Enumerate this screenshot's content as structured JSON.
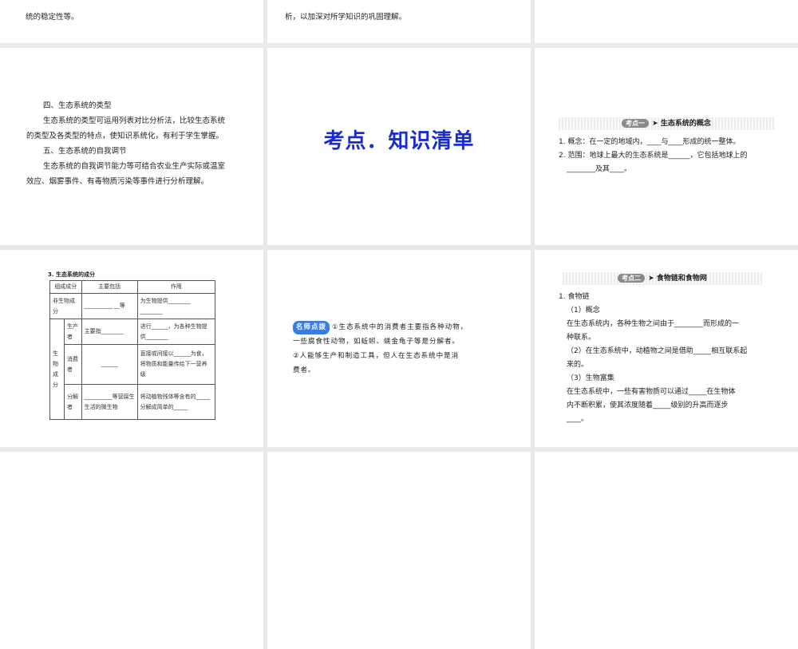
{
  "slides": {
    "s1": {
      "line": "统的稳定性等。"
    },
    "s2": {
      "line": "析，以加深对所学知识的巩固理解。"
    },
    "s4": {
      "lines": [
        "四、生态系统的类型",
        "生态系统的类型可运用列表对比分析法，比较生态系统",
        "的类型及各类型的特点，使知识系统化，有利于学生掌握。",
        "五、生态系统的自我调节",
        "生态系统的自我调节能力等可结合农业生产实际或温室",
        "效应、烟雾事件、有毒物质污染等事件进行分析理解。"
      ]
    },
    "s5": {
      "title": "考点．知识清单"
    },
    "s6": {
      "badge": "考点一",
      "heading": "➤ 生态系统的概念",
      "lines": [
        "1. 概念：在一定的地域内，____与____形成的统一整体。",
        "2. 范围：地球上最大的生态系统是______，它包括地球上的",
        "________及其____。"
      ]
    },
    "s7": {
      "title": "3. 生态系统的成分",
      "headers": [
        "组成成分",
        "主要包括",
        "作用"
      ],
      "nonbio": "非生物成分",
      "nonbio_main": "__________ __等",
      "nonbio_role": "为生物提供________ ________",
      "bio": "生物成分",
      "producer": "生产者",
      "producer_main": "主要指________",
      "producer_role": "进行______，为各种生物提供________",
      "consumer": "消费者",
      "consumer_main": "______",
      "consumer_role": "直接或间接以______为食，将物质和能量传给下一营养级",
      "decomposer": "分解者",
      "decomposer_main": "__________等营腐生生活的微生物",
      "decomposer_role": "将动植物残体等含有的_____分解成简单的_____"
    },
    "s8": {
      "badge": "名师点拨",
      "lines": [
        "①生态系统中的消费者主要指各种动物，",
        "一些腐食性动物，如蚯蚓、蜣金龟子等是分解者。",
        "②人能够生产和制造工具，但人在生态系统中是消",
        "费者。"
      ]
    },
    "s9": {
      "badge": "考点二",
      "heading": "➤ 食物链和食物网",
      "lines": [
        "1. 食物链",
        "（1）概念",
        "在生态系统内，各种生物之间由于________而形成的一",
        "种联系。",
        "（2）在生态系统中，动植物之间是借助_____相互联系起",
        "来的。",
        "（3）生物富集",
        "在生态系统中，一些有害物质可以通过_____在生物体",
        "内不断积累，使其浓度随着_____级别的升高而逐步",
        "____。"
      ]
    }
  }
}
